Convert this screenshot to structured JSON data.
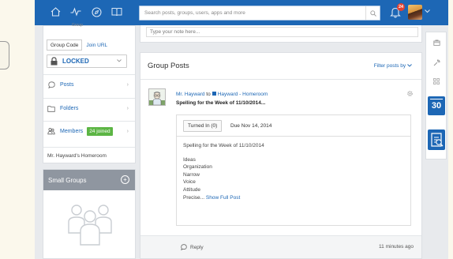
{
  "topbar": {
    "search_placeholder": "Search posts, groups, users, apps and more",
    "notification_count": "24",
    "nav_icons": [
      "home-icon",
      "activity-icon",
      "compass-icon",
      "book-icon"
    ],
    "brand_color": "#1d67b5"
  },
  "sidebar": {
    "group_label": "Group",
    "tabs": [
      {
        "label": "Group Code"
      },
      {
        "label": "Join URL"
      }
    ],
    "lock_status": "LOCKED",
    "items": [
      {
        "label": "Posts",
        "icon": "speech-bubble-icon"
      },
      {
        "label": "Folders",
        "icon": "folder-icon"
      },
      {
        "label": "Members",
        "icon": "members-icon",
        "badge": "24 joined"
      }
    ],
    "group_name": "Mr. Hayward's Homeroom"
  },
  "small_groups": {
    "title": "Small Groups"
  },
  "note": {
    "placeholder": "Type your note here..."
  },
  "posts": {
    "title": "Group Posts",
    "filter_label": "Filter posts by",
    "post": {
      "author": "Mr. Hayward",
      "to_word": "to",
      "group": "Hayward - Homeroom",
      "headline": "Spelling for the Week of 11/10/2014...",
      "turned_in": "Turned In (0)",
      "due": "Due Nov 14, 2014",
      "body_title": "Spelling for the Week of 11/10/2014",
      "words": [
        "Ideas",
        "Organization",
        "Narrow",
        "Voice",
        "Attitude"
      ],
      "last_word": "Precise...",
      "show_full": "Show Full Post",
      "reply_label": "Reply",
      "timestamp": "11 minutes ago"
    }
  },
  "tools": {
    "calendar_day": "30"
  },
  "colors": {
    "accent": "#1d67b5",
    "joined_badge": "#5cb544",
    "notification_badge": "#e4412f",
    "small_groups_header": "#8f96a0"
  }
}
